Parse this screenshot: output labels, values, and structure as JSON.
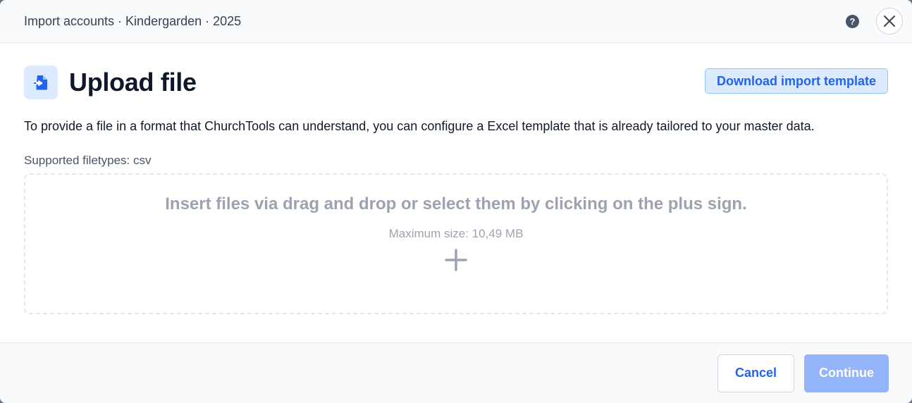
{
  "header": {
    "breadcrumb": "Import accounts · Kindergarden · 2025",
    "help_icon": "question-circle-icon",
    "help_glyph": "?",
    "close_icon": "close-icon"
  },
  "main": {
    "title_icon": "file-import-icon",
    "title": "Upload file",
    "template_button_label": "Download import template",
    "description": "To provide a file in a format that ChurchTools can understand, you can configure a Excel template that is already tailored to your master data.",
    "filetypes": "Supported filetypes: csv",
    "dropzone": {
      "title": "Insert files via drag and drop or select them by clicking on the plus sign.",
      "max_size": "Maximum size: 10,49 MB",
      "plus_icon": "plus-icon"
    }
  },
  "footer": {
    "cancel_label": "Cancel",
    "continue_label": "Continue"
  },
  "colors": {
    "accent": "#2563eb",
    "accent_light": "#dbeafe",
    "continue_disabled": "#93b4f8",
    "muted_text": "#9ca3af"
  }
}
